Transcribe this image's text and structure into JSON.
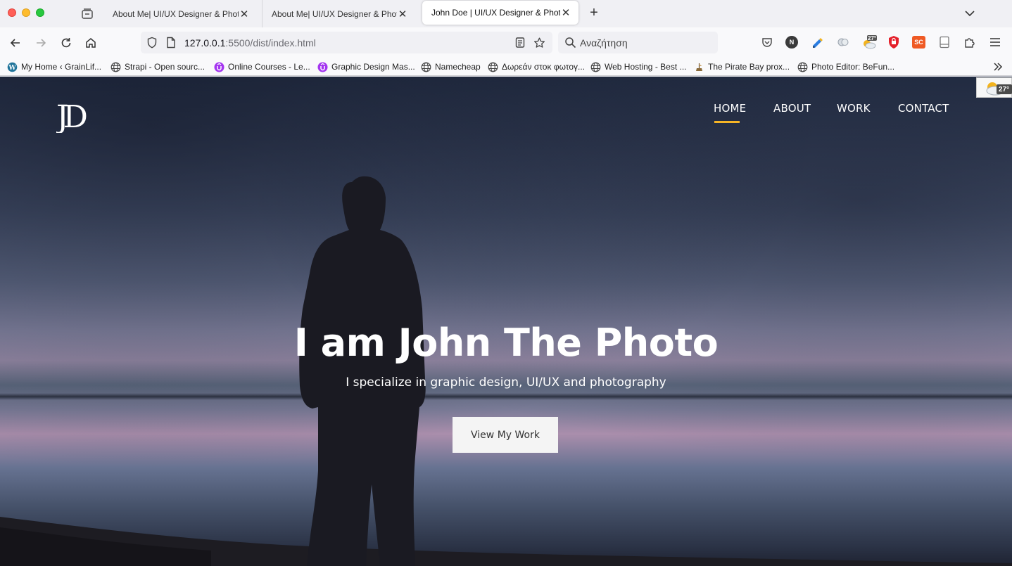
{
  "browser": {
    "tabs": [
      {
        "title": "About Me| UI/UX Designer & Photog"
      },
      {
        "title": "About Me| UI/UX Designer & Photog"
      },
      {
        "title": "John Doe | UI/UX Designer & Photo",
        "active": true
      }
    ],
    "url_host": "127.0.0.1",
    "url_rest": ":5500/dist/index.html",
    "search_placeholder": "Αναζήτηση",
    "weather_temp": "27°",
    "ext_sc_label": "SC",
    "ext_n_label": "N",
    "bookmarks": [
      {
        "label": "My Home ‹ GrainLif...",
        "icon": "wordpress-icon"
      },
      {
        "label": "Strapi - Open sourc...",
        "icon": "globe-icon"
      },
      {
        "label": "Online Courses - Le...",
        "icon": "udemy-icon"
      },
      {
        "label": "Graphic Design Mas...",
        "icon": "udemy-icon"
      },
      {
        "label": "Namecheap",
        "icon": "globe-icon"
      },
      {
        "label": "Δωρεάν στοκ φωτογ...",
        "icon": "globe-icon"
      },
      {
        "label": "Web Hosting - Best ...",
        "icon": "globe-icon"
      },
      {
        "label": "The Pirate Bay prox...",
        "icon": "pirate-icon"
      },
      {
        "label": "Photo Editor: BeFun...",
        "icon": "globe-icon"
      }
    ]
  },
  "site": {
    "logo_text": "JD",
    "nav": {
      "home": "HOME",
      "about": "ABOUT",
      "work": "WORK",
      "contact": "CONTACT"
    },
    "hero": {
      "title": "I am John The Photo",
      "subtitle": "I specialize in graphic design, UI/UX and photography",
      "button": "View My Work"
    }
  },
  "colors": {
    "accent": "#f6b526",
    "button_bg": "#f4f4f4"
  }
}
